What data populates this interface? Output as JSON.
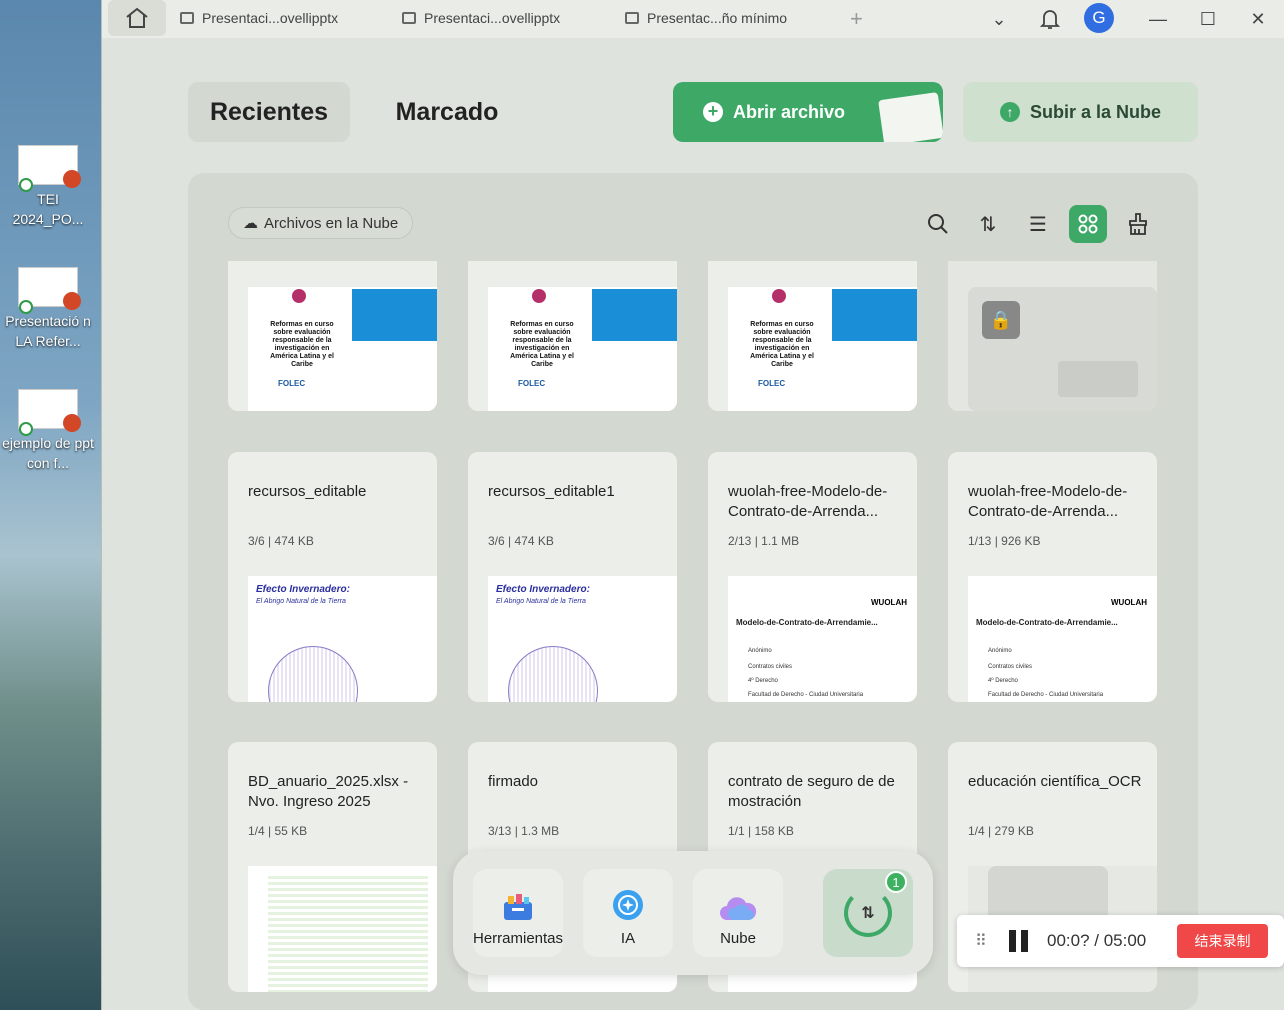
{
  "desktop": {
    "icons": [
      {
        "label": "TEI 2024_PO..."
      },
      {
        "label": "Presentació n LA Refer..."
      },
      {
        "label": "ejemplo de ppt con f..."
      }
    ]
  },
  "titlebar": {
    "tabs": [
      "Presentaci...ovellipptx",
      "Presentaci...ovellipptx",
      "Presentac...ño mínimo"
    ],
    "avatar": "G"
  },
  "nav": {
    "recent": "Recientes",
    "marked": "Marcado",
    "open": "Abrir archivo",
    "upload": "Subir a la Nube"
  },
  "panel": {
    "chip": "Archivos en la Nube"
  },
  "thumb": {
    "title": "Reformas en curso sobre evaluación responsable de la investigación en América Latina y el Caribe",
    "logo": "FOLEC",
    "greenhouse": "Efecto Invernadero:",
    "greenhouse_sub": "El Abrigo Natural de la Tierra",
    "wlogo": "WUOLAH",
    "wtitle": "Modelo-de-Contrato-de-Arrendamie...",
    "w1": "Anónimo",
    "w2": "Contratos civiles",
    "w3": "4º Derecho",
    "w4": "Facultad de Derecho - Ciudad Universitaria"
  },
  "cards": [
    {
      "name": "recursos_editable",
      "meta": "3/6 | 474 KB"
    },
    {
      "name": "recursos_editable1",
      "meta": "3/6 | 474 KB"
    },
    {
      "name": "wuolah-free-Modelo-de-Contrato-de-Arrenda...",
      "meta": "2/13 | 1.1 MB"
    },
    {
      "name": "wuolah-free-Modelo-de-Contrato-de-Arrenda...",
      "meta": "1/13 | 926 KB"
    },
    {
      "name": "BD_anuario_2025.xlsx - Nvo. Ingreso 2025",
      "meta": "1/4 | 55 KB"
    },
    {
      "name": "firmado",
      "meta": "3/13 | 1.3 MB"
    },
    {
      "name": "contrato de seguro de de mostración",
      "meta": "1/1 | 158 KB"
    },
    {
      "name": "educación científica_OCR",
      "meta": "1/4 | 279 KB"
    }
  ],
  "dock": {
    "tools": "Herramientas",
    "ai": "IA",
    "cloud": "Nube",
    "badge": "1"
  },
  "recorder": {
    "time": "00:0? / 05:00",
    "stop": "结束录制"
  }
}
